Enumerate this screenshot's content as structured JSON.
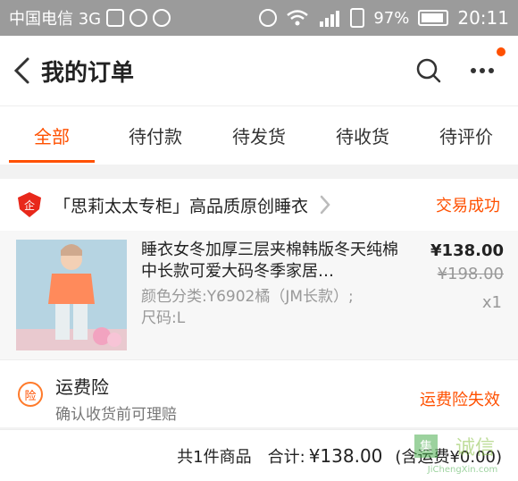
{
  "status_bar": {
    "carrier": "中国电信 3G",
    "network": "3G",
    "battery": "97%",
    "time": "20:11"
  },
  "header": {
    "title": "我的订单",
    "back_icon": "chevron-left-icon",
    "search_icon": "search-icon",
    "more_icon": "more-icon",
    "notification_dot_color": "#ff5000"
  },
  "tabs": [
    {
      "label": "全部",
      "active": true
    },
    {
      "label": "待付款",
      "active": false
    },
    {
      "label": "待发货",
      "active": false
    },
    {
      "label": "待收货",
      "active": false
    },
    {
      "label": "待评价",
      "active": false
    }
  ],
  "shop": {
    "name": "「思莉太太专柜」高品质原创睡衣",
    "status": "交易成功",
    "icon": "shop-badge-icon"
  },
  "product": {
    "title": "睡衣女冬加厚三层夹棉韩版冬天纯棉中长款可爱大码冬季家居…",
    "spec": "颜色分类:Y6902橘（JM长款）;尺码:L",
    "price": "¥138.00",
    "original_price": "¥198.00",
    "quantity": "x1"
  },
  "insurance": {
    "icon_label": "险",
    "title": "运费险",
    "subtitle": "确认收货前可理赔",
    "status": "运费险失效"
  },
  "summary": {
    "count": "共1件商品",
    "total_label": "合计:",
    "total_value": "¥138.00",
    "shipping": "(含运费¥0.00)"
  },
  "watermark": {
    "text": "诚信",
    "domain": "JiChengXin.com"
  },
  "colors": {
    "accent": "#ff5000",
    "status_bar": "#9b9b9b"
  }
}
